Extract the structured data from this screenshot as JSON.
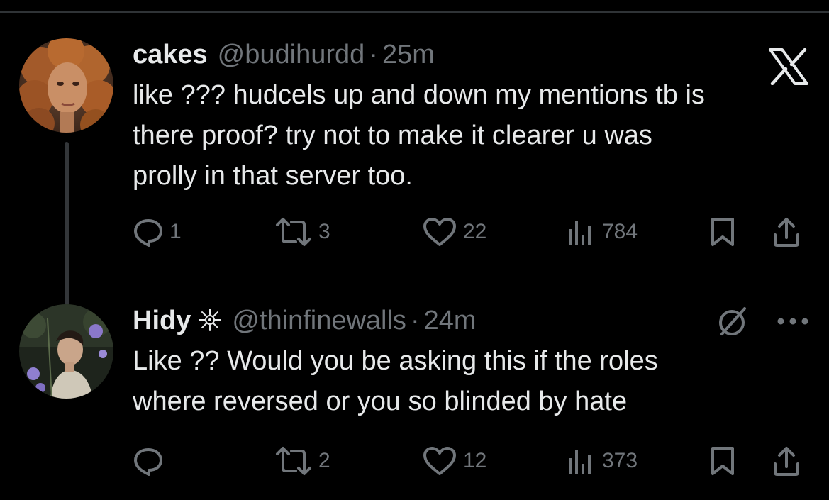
{
  "tweets": [
    {
      "author_name": "cakes",
      "handle": "@budihurdd",
      "separator": "·",
      "time": "25m",
      "text_lines": [
        "like ??? hudcels up and down my mentions tb is",
        "there proof? try not to make it clearer u was",
        "prolly in that server too."
      ],
      "replies": "1",
      "retweets": "3",
      "likes": "22",
      "views": "784",
      "avatar_icon": "avatar-photo",
      "accent": "#71767b"
    },
    {
      "author_name": "Hidy",
      "handle": "@thinfinewalls",
      "separator": "·",
      "time": "24m",
      "text_lines": [
        "Like ?? Would you be asking this if the roles",
        "where reversed or you so blinded by hate"
      ],
      "replies": "",
      "retweets": "2",
      "likes": "12",
      "views": "373",
      "avatar_icon": "avatar-photo",
      "accent": "#71767b"
    }
  ],
  "icons": {
    "brand": "x-logo-icon",
    "reply": "reply-icon",
    "retweet": "retweet-icon",
    "like": "heart-icon",
    "views": "views-chart-icon",
    "bookmark": "bookmark-icon",
    "share": "share-icon",
    "edit": "edit-history-icon",
    "more": "more-options-icon",
    "badge": "sparkle-badge-icon"
  },
  "colors": {
    "background": "#000000",
    "text_primary": "#e7e9ea",
    "text_secondary": "#71767b",
    "thread_line": "#333639"
  }
}
